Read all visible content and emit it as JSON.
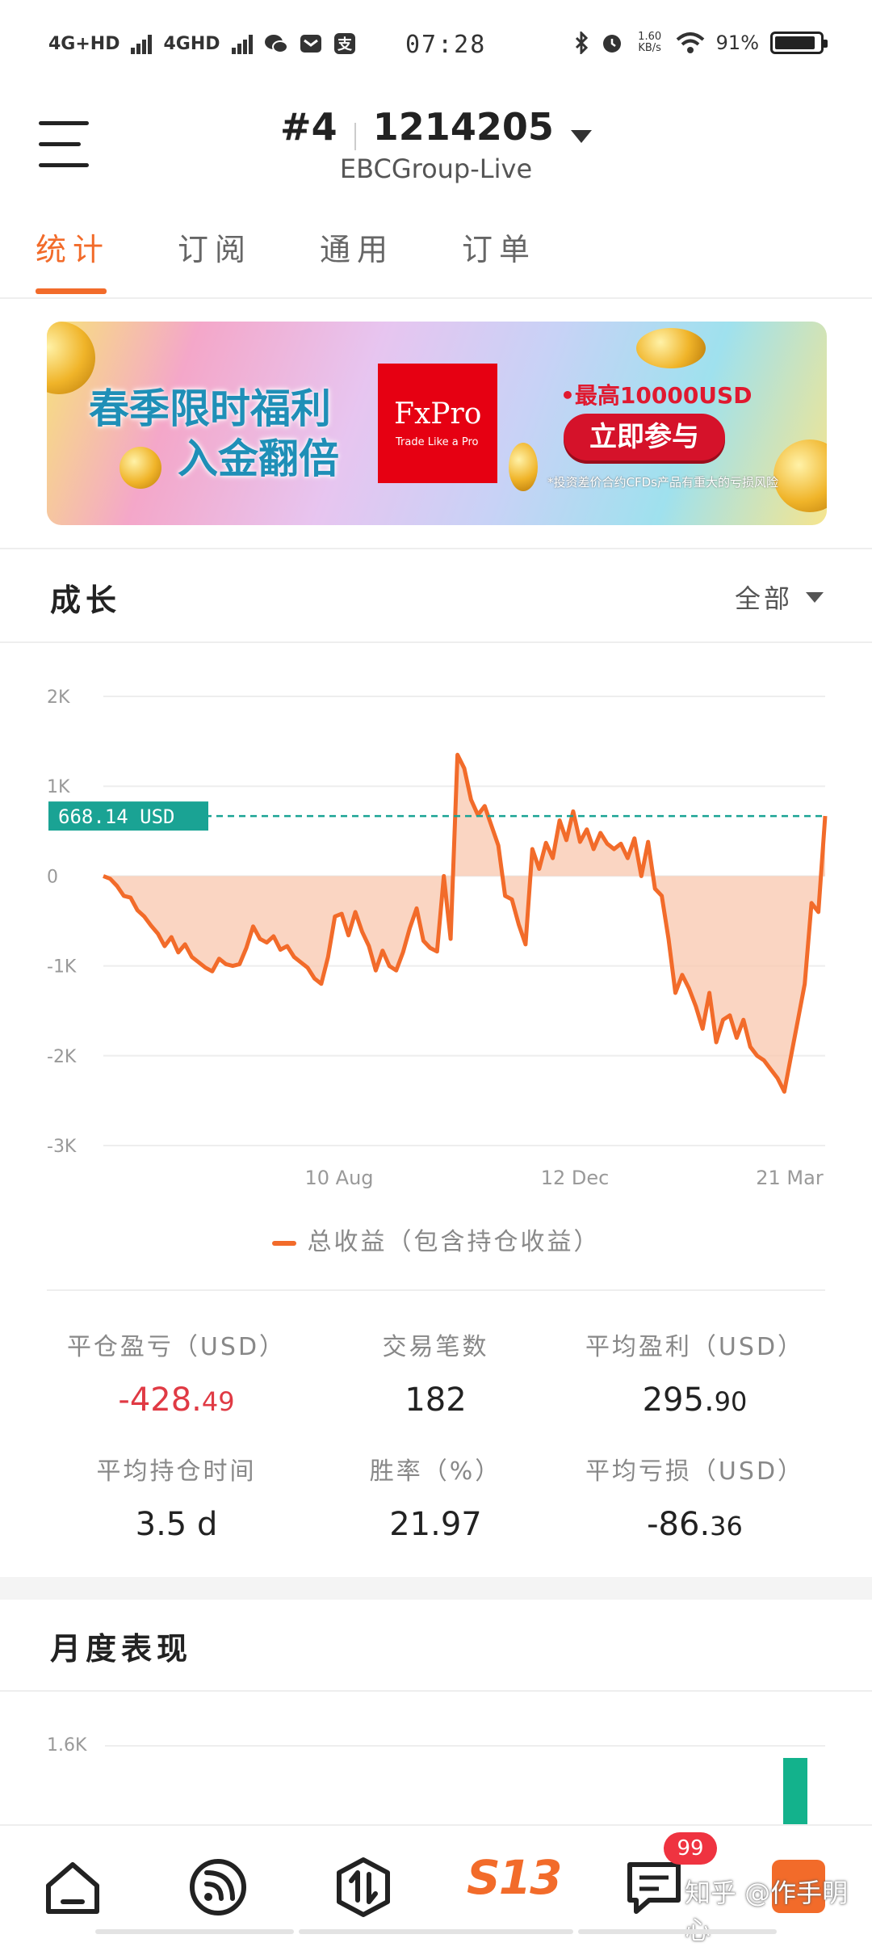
{
  "status_bar": {
    "network1": "4G+HD",
    "network2": "4GHD",
    "time": "07:28",
    "net_speed": "1.60 KB/s",
    "battery": "91%",
    "battery_level": 0.91
  },
  "header": {
    "account_id": "#4",
    "account_number": "1214205",
    "server": "EBCGroup-Live"
  },
  "tabs": [
    "统计",
    "订阅",
    "通用",
    "订单"
  ],
  "banner": {
    "line1": "春季限时福利",
    "line2": "入金翻倍",
    "logo": "FxPro",
    "logo_sub": "Trade Like a Pro",
    "max_text": "•最高10000USD",
    "cta": "立即参与",
    "risk": "*投资差价合约CFDs产品有重大的亏损风险"
  },
  "growth": {
    "title": "成长",
    "filter": "全部"
  },
  "chart_data": {
    "type": "area",
    "y_ticks": [
      "2K",
      "1K",
      "0",
      "-1K",
      "-2K",
      "-3K"
    ],
    "ylim": [
      -3000,
      2000
    ],
    "x_ticks": [
      "10 Aug",
      "12 Dec",
      "21 Mar"
    ],
    "current_label": "668.14 USD",
    "current_value": 668.14,
    "series": [
      {
        "name": "总收益（包含持仓收益）",
        "color": "#f26b2a",
        "values": [
          0,
          -30,
          -110,
          -220,
          -240,
          -380,
          -450,
          -550,
          -640,
          -780,
          -680,
          -850,
          -760,
          -900,
          -960,
          -1020,
          -1060,
          -920,
          -980,
          -1000,
          -980,
          -800,
          -560,
          -700,
          -740,
          -670,
          -820,
          -780,
          -900,
          -960,
          -1020,
          -1140,
          -1200,
          -900,
          -450,
          -420,
          -660,
          -400,
          -620,
          -780,
          -1050,
          -830,
          -1000,
          -1050,
          -850,
          -580,
          -360,
          -720,
          -800,
          -840,
          0,
          -700,
          1350,
          1200,
          850,
          680,
          780,
          560,
          340,
          -220,
          -260,
          -540,
          -760,
          300,
          80,
          370,
          200,
          620,
          400,
          720,
          380,
          520,
          300,
          480,
          360,
          300,
          360,
          200,
          420,
          0,
          380,
          -140,
          -220,
          -700,
          -1300,
          -1100,
          -1250,
          -1450,
          -1700,
          -1300,
          -1850,
          -1600,
          -1550,
          -1800,
          -1600,
          -1900,
          -2000,
          -2050,
          -2150,
          -2250,
          -2400,
          -2000,
          -1600,
          -1200,
          -300,
          -400,
          668
        ]
      }
    ]
  },
  "stats": [
    {
      "label": "平仓盈亏（USD）",
      "int": "-428.",
      "dec": "49",
      "negative": true
    },
    {
      "label": "交易笔数",
      "int": "182",
      "dec": "",
      "negative": false
    },
    {
      "label": "平均盈利（USD）",
      "int": "295.",
      "dec": "90",
      "negative": false
    },
    {
      "label": "平均持仓时间",
      "int": "3.5 d",
      "dec": "",
      "negative": false
    },
    {
      "label": "胜率（%）",
      "int": "21.97",
      "dec": "",
      "negative": false
    },
    {
      "label": "平均亏损（USD）",
      "int": "-86.",
      "dec": "36",
      "negative": false
    }
  ],
  "monthly": {
    "title": "月度表现",
    "y_tick": "1.6K"
  },
  "nav": {
    "items": [
      "home-icon",
      "feed-icon",
      "trade-icon",
      "s13-logo",
      "messages-icon",
      "profile-icon"
    ],
    "brand": "S13",
    "badge": "99",
    "watermark": "知乎 @作手明心"
  }
}
